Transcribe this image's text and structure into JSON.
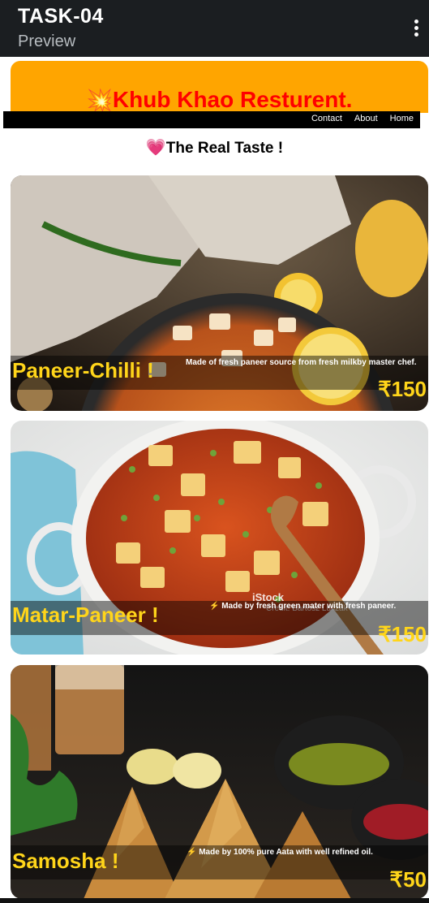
{
  "appbar": {
    "title": "TASK-04",
    "subtitle": "Preview",
    "menu_icon": "more-vert-icon"
  },
  "banner": {
    "icon": "💥",
    "brand": "Khub Khao Resturent."
  },
  "nav": {
    "links": [
      "Contact",
      "About",
      "Home"
    ]
  },
  "tagline": {
    "icon": "💗",
    "text": "The Real Taste !"
  },
  "dishes": [
    {
      "name": "Paneer-Chilli !",
      "description": "Made of fresh paneer source from fresh milkby master chef.",
      "price": "₹150"
    },
    {
      "name": "Matar-Paneer !",
      "description": "⚡ Made by fresh green mater with fresh paneer.",
      "price": "₹150",
      "watermark": "iStock",
      "credit": "Credit: Bartosz Luczak"
    },
    {
      "name": "Samosha !",
      "description": "⚡ Made by 100% pure Aata with well refined oil.",
      "price": "₹50"
    }
  ],
  "colors": {
    "appbar": "#1b1e21",
    "banner": "#ffa500",
    "brand": "#ff0000",
    "dish_text": "#ffd51a",
    "heart": "#ff3399"
  }
}
